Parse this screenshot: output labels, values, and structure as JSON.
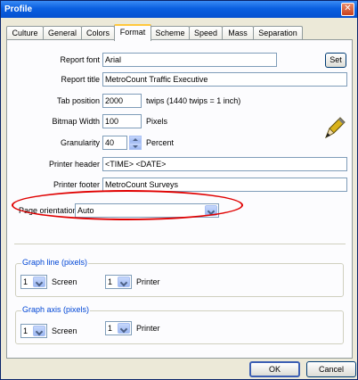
{
  "window": {
    "title": "Profile",
    "close_glyph": "✕"
  },
  "tabs": [
    {
      "label": "Culture"
    },
    {
      "label": "General"
    },
    {
      "label": "Colors"
    },
    {
      "label": "Format"
    },
    {
      "label": "Scheme"
    },
    {
      "label": "Speed"
    },
    {
      "label": "Mass"
    },
    {
      "label": "Separation"
    }
  ],
  "format": {
    "report_font": {
      "label": "Report font",
      "value": "Arial",
      "set_button": "Set"
    },
    "report_title": {
      "label": "Report title",
      "value": "MetroCount Traffic Executive"
    },
    "tab_position": {
      "label": "Tab position",
      "value": "2000",
      "unit": "twips (1440 twips = 1 inch)"
    },
    "bitmap_width": {
      "label": "Bitmap Width",
      "value": "100",
      "unit": "Pixels"
    },
    "granularity": {
      "label": "Granularity",
      "value": "40",
      "unit": "Percent"
    },
    "printer_header": {
      "label": "Printer header",
      "value": "<TIME> <DATE>"
    },
    "printer_footer": {
      "label": "Printer footer",
      "value": "MetroCount Surveys"
    },
    "page_orientation": {
      "label": "Page orientation",
      "value": "Auto"
    }
  },
  "graph_line": {
    "title": "Graph line (pixels)",
    "screen_value": "1",
    "screen_label": "Screen",
    "printer_value": "1",
    "printer_label": "Printer"
  },
  "graph_axis": {
    "title": "Graph axis (pixels)",
    "screen_value": "1",
    "screen_label": "Screen",
    "printer_value": "1",
    "printer_label": "Printer"
  },
  "buttons": {
    "ok": "OK",
    "cancel": "Cancel"
  },
  "colors": {
    "title_bar": "#0a5fe0",
    "highlight_ellipse": "#e00000",
    "group_title": "#0046d5"
  },
  "icons": {
    "pen": "pen-icon"
  }
}
